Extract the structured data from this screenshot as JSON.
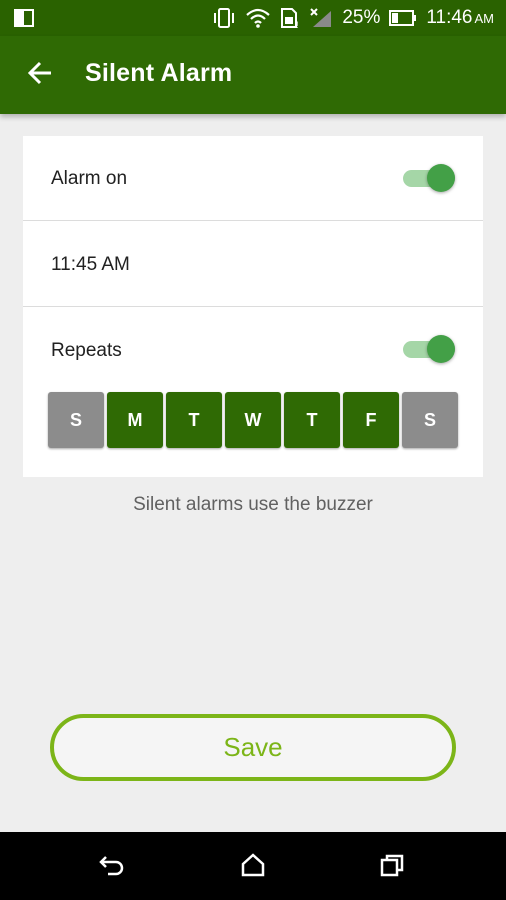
{
  "status_bar": {
    "battery_percent": "25%",
    "time": "11:46",
    "ampm": "AM",
    "icons": [
      "screen-mirror-icon",
      "vibrate-icon",
      "wifi-icon",
      "sim-icon",
      "signal-icon",
      "battery-icon"
    ]
  },
  "app_bar": {
    "title": "Silent Alarm",
    "back_icon": "arrow-back-icon"
  },
  "settings": {
    "alarm_on": {
      "label": "Alarm on",
      "enabled": true
    },
    "time": {
      "value": "11:45 AM"
    },
    "repeats": {
      "label": "Repeats",
      "enabled": true
    },
    "days": [
      {
        "label": "S",
        "selected": false
      },
      {
        "label": "M",
        "selected": true
      },
      {
        "label": "T",
        "selected": true
      },
      {
        "label": "W",
        "selected": true
      },
      {
        "label": "T",
        "selected": true
      },
      {
        "label": "F",
        "selected": true
      },
      {
        "label": "S",
        "selected": false
      }
    ]
  },
  "hint": "Silent alarms use the buzzer",
  "save_label": "Save",
  "colors": {
    "primary": "#2f6a04",
    "accent_green": "#43a047",
    "save_green": "#7cb518",
    "day_off": "#8c8c8c"
  },
  "nav_bar": {
    "icons": [
      "back-icon",
      "home-icon",
      "recents-icon"
    ]
  }
}
